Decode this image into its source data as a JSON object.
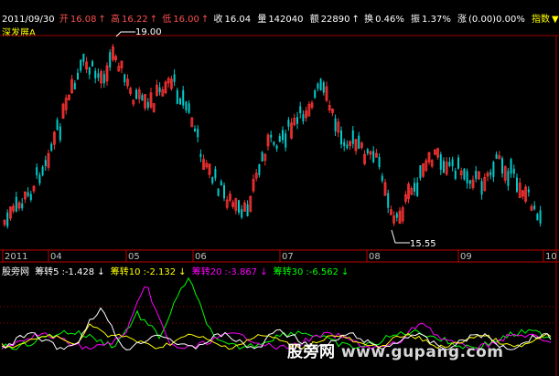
{
  "header": {
    "date": "2011/09/30",
    "open_label": "开",
    "open": "16.08",
    "high_label": "高",
    "high": "16.22",
    "low_label": "低",
    "low": "16.00",
    "close_label": "收",
    "close": "16.04",
    "volume_label": "量",
    "volume": "142040",
    "amount_label": "额",
    "amount": "22890",
    "turnover_label": "换",
    "turnover": "0.46%",
    "amplitude_label": "振",
    "amplitude": "1.37%",
    "change_label": "涨",
    "change": "(0.00)0.00%",
    "index_label": "指数"
  },
  "stock_name": "深发展A",
  "price_annotations": {
    "max": "19.00",
    "min": "15.55"
  },
  "x_axis": {
    "labels": [
      "2011",
      "04",
      "05",
      "06",
      "07",
      "08",
      "09",
      "10"
    ]
  },
  "indicator": {
    "name": "股旁网",
    "series": [
      {
        "label": "筹转5",
        "value": "-1.428",
        "color": "#ffffff"
      },
      {
        "label": "筹转10",
        "value": "-2.132",
        "color": "#ffff00"
      },
      {
        "label": "筹转20",
        "value": "-3.867",
        "color": "#ff00ff"
      },
      {
        "label": "筹转30",
        "value": "-6.562",
        "color": "#00ff00"
      }
    ]
  },
  "watermark": {
    "text_cn": "股旁网",
    "domain": "www.gupang.com"
  },
  "colors": {
    "up": "#ff3333",
    "down": "#00cccc",
    "grid": "#a00000",
    "axis": "#c00000"
  }
}
